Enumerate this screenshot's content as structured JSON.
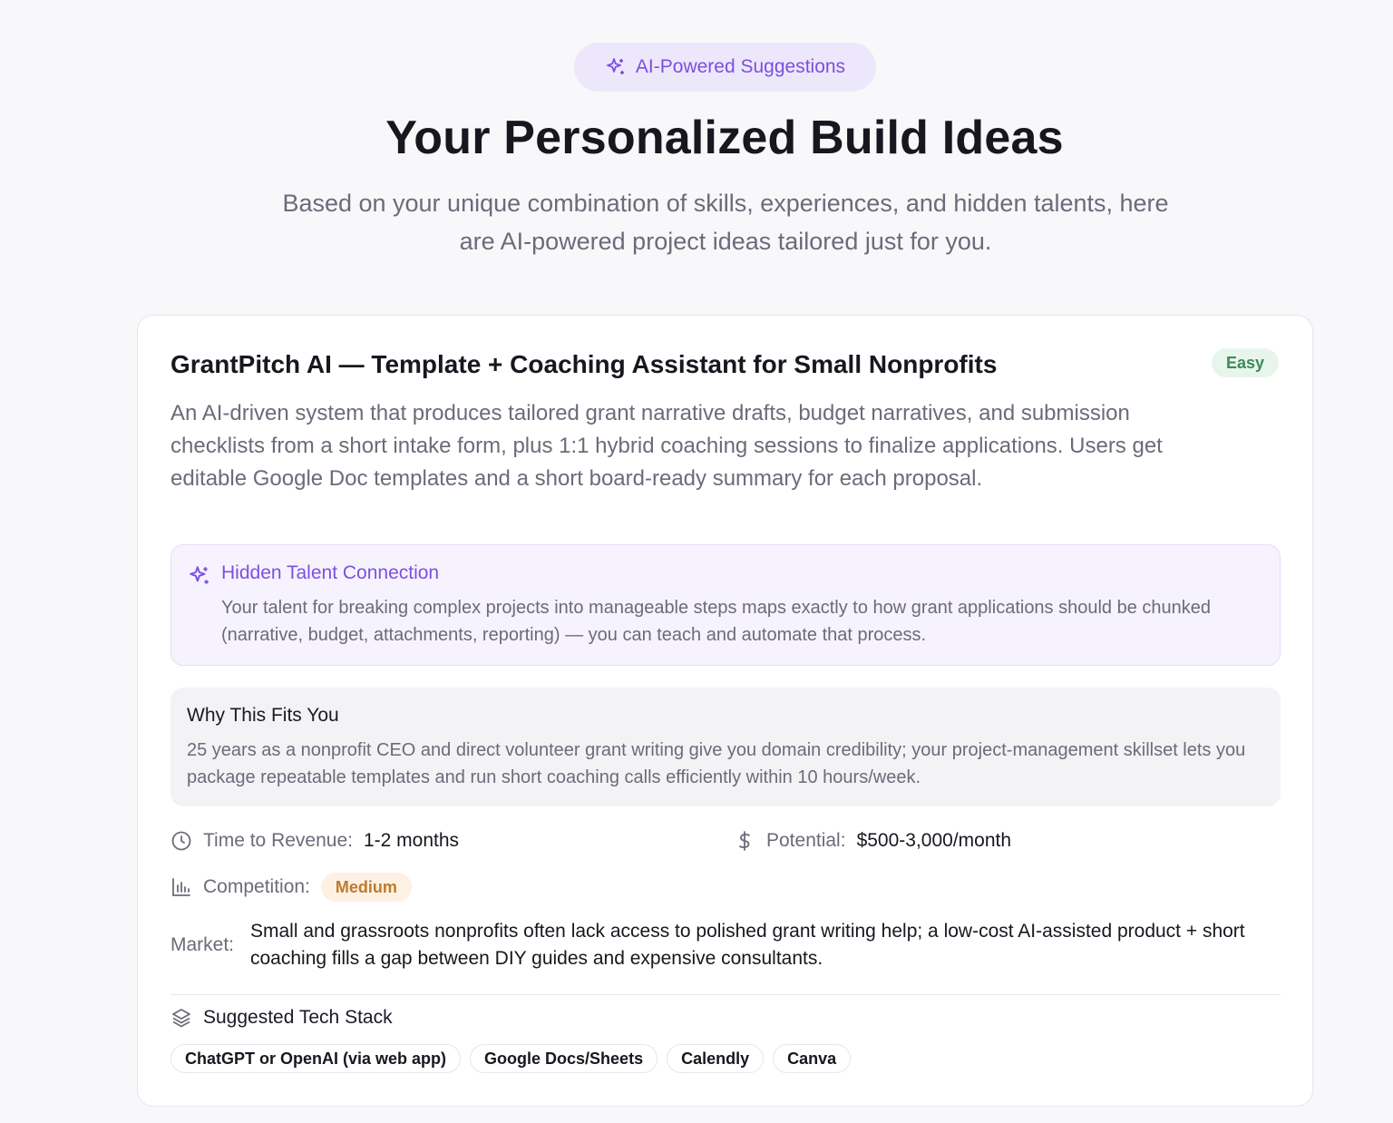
{
  "badge": {
    "label": "AI-Powered Suggestions",
    "icon": "sparkles-icon",
    "color": "#7c4fe0"
  },
  "header": {
    "title": "Your Personalized Build Ideas",
    "subtitle": "Based on your unique combination of skills, experiences, and hidden talents, here are AI-powered project ideas tailored just for you."
  },
  "idea": {
    "title": "GrantPitch AI — Template + Coaching Assistant for Small Nonprofits",
    "difficulty": "Easy",
    "description": "An AI-driven system that produces tailored grant narrative drafts, budget narratives, and submission checklists from a short intake form, plus 1:1 hybrid coaching sessions to finalize applications. Users get editable Google Doc templates and a short board-ready summary for each proposal.",
    "talent": {
      "heading": "Hidden Talent Connection",
      "text": "Your talent for breaking complex projects into manageable steps maps exactly to how grant applications should be chunked (narrative, budget, attachments, reporting) — you can teach and automate that process."
    },
    "fit": {
      "heading": "Why This Fits You",
      "text": "25 years as a nonprofit CEO and direct volunteer grant writing give you domain credibility; your project-management skillset lets you package repeatable templates and run short coaching calls efficiently within 10 hours/week."
    },
    "time_to_revenue": {
      "label": "Time to Revenue:",
      "value": "1-2 months"
    },
    "potential": {
      "label": "Potential:",
      "value": "$500-3,000/month"
    },
    "competition": {
      "label": "Competition:",
      "value": "Medium"
    },
    "market": {
      "label": "Market:",
      "text": "Small and grassroots nonprofits often lack access to polished grant writing help; a low-cost AI-assisted product + short coaching fills a gap between DIY guides and expensive consultants."
    },
    "tech_stack": {
      "heading": "Suggested Tech Stack",
      "items": [
        "ChatGPT or OpenAI (via web app)",
        "Google Docs/Sheets",
        "Calendly",
        "Canva"
      ]
    }
  }
}
